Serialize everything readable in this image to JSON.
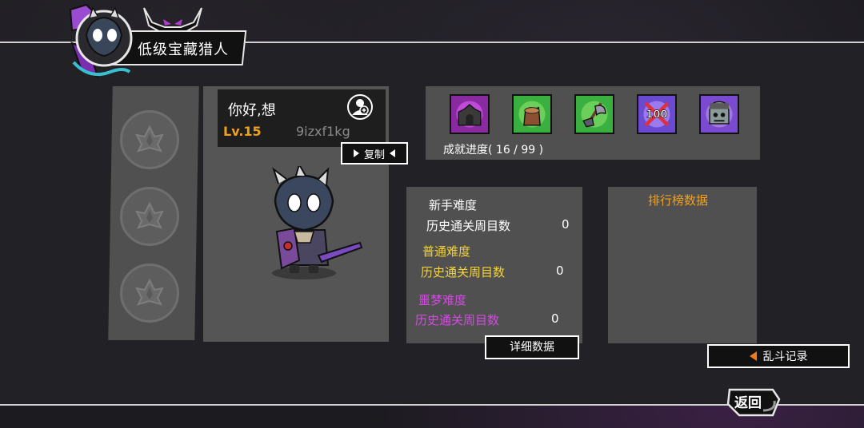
{
  "header": {
    "title": "低级宝藏猎人"
  },
  "player": {
    "name": "你好,想",
    "level": "Lv.15",
    "id": "9izxf1kg",
    "copy_label": "复制"
  },
  "achievements": {
    "icons": [
      "castle-gate-icon",
      "tree-stump-icon",
      "axe-icon",
      "crossed-100-icon",
      "zombie-head-icon"
    ],
    "progress_text": "成就进度( 16 / 99 )"
  },
  "stats": {
    "novice": {
      "label": "新手难度",
      "row_label": "历史通关周目数",
      "value": "0"
    },
    "normal": {
      "label": "普通难度",
      "row_label": "历史通关周目数",
      "value": "0"
    },
    "nightmare": {
      "label": "噩梦难度",
      "row_label": "历史通关周目数",
      "value": "0"
    },
    "detail_label": "详细数据"
  },
  "leaderboard": {
    "title": "排行榜数据"
  },
  "buttons": {
    "brawl_label": "乱斗记录",
    "back_label": "返回"
  },
  "colors": {
    "accent_orange": "#f0a020",
    "yellow": "#f3d23a",
    "purple": "#d24be0",
    "panel_gray": "#505050"
  }
}
